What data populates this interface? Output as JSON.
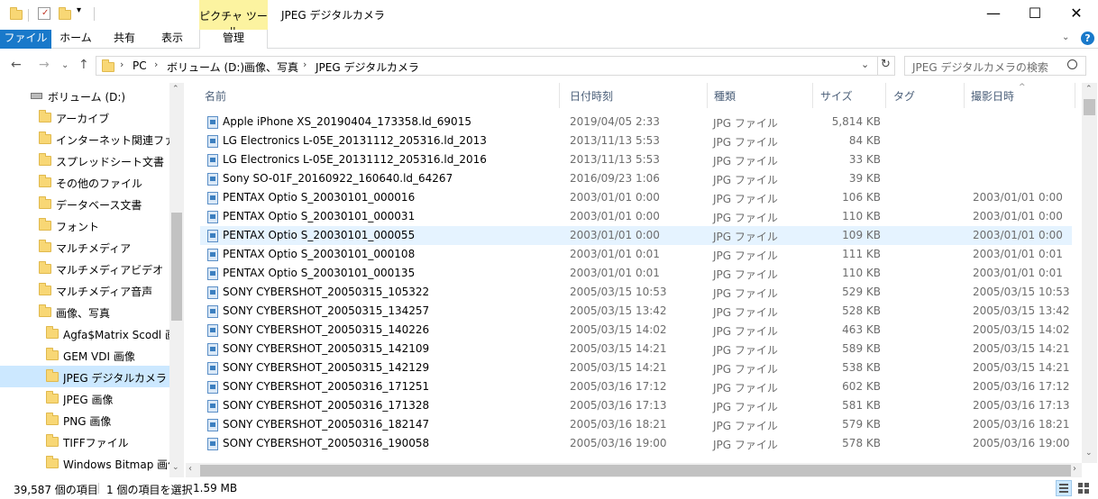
{
  "window": {
    "title": "JPEG デジタルカメラ",
    "context_tab": "ピクチャ ツール",
    "minimize_icon": "minimize-icon",
    "maximize_icon": "maximize-icon",
    "close_icon": "close-icon"
  },
  "ribbon": {
    "tabs": [
      "ファイル",
      "ホーム",
      "共有",
      "表示"
    ],
    "context_tab_label": "管理"
  },
  "nav": {
    "breadcrumb": [
      "PC",
      "ボリューム (D:)",
      "画像、写真",
      "JPEG デジタルカメラ"
    ],
    "search_placeholder": "JPEG デジタルカメラの検索"
  },
  "tree": [
    {
      "label": "ボリューム (D:)",
      "icon": "drive-icon",
      "indent": 1
    },
    {
      "label": "アーカイブ",
      "icon": "folder-icon",
      "indent": 2
    },
    {
      "label": "インターネット関連ファイル",
      "icon": "folder-icon",
      "indent": 2
    },
    {
      "label": "スプレッドシート文書",
      "icon": "folder-icon",
      "indent": 2
    },
    {
      "label": "その他のファイル",
      "icon": "folder-icon",
      "indent": 2
    },
    {
      "label": "データベース文書",
      "icon": "folder-icon",
      "indent": 2
    },
    {
      "label": "フォント",
      "icon": "folder-icon",
      "indent": 2
    },
    {
      "label": "マルチメディア",
      "icon": "folder-icon",
      "indent": 2
    },
    {
      "label": "マルチメディアビデオ",
      "icon": "folder-icon",
      "indent": 2
    },
    {
      "label": "マルチメディア音声",
      "icon": "folder-icon",
      "indent": 2
    },
    {
      "label": "画像、写真",
      "icon": "folder-icon",
      "indent": 2
    },
    {
      "label": "Agfa$Matrix Scodl 画像",
      "icon": "folder-icon",
      "indent": 3
    },
    {
      "label": "GEM VDI 画像",
      "icon": "folder-icon",
      "indent": 3
    },
    {
      "label": "JPEG デジタルカメラ",
      "icon": "folder-icon",
      "indent": 3,
      "selected": true
    },
    {
      "label": "JPEG 画像",
      "icon": "folder-icon",
      "indent": 3
    },
    {
      "label": "PNG 画像",
      "icon": "folder-icon",
      "indent": 3
    },
    {
      "label": "TIFFファイル",
      "icon": "folder-icon",
      "indent": 3
    },
    {
      "label": "Windows Bitmap 画像",
      "icon": "folder-icon",
      "indent": 3
    }
  ],
  "columns": [
    "名前",
    "日付時刻",
    "種類",
    "サイズ",
    "タグ",
    "撮影日時"
  ],
  "files": [
    {
      "name": "Apple iPhone XS_20190404_173358.ld_69015",
      "date": "2019/04/05 2:33",
      "type": "JPG ファイル",
      "size": "5,814 KB",
      "shot": ""
    },
    {
      "name": "LG Electronics L-05E_20131112_205316.ld_2013",
      "date": "2013/11/13 5:53",
      "type": "JPG ファイル",
      "size": "84 KB",
      "shot": ""
    },
    {
      "name": "LG Electronics L-05E_20131112_205316.ld_2016",
      "date": "2013/11/13 5:53",
      "type": "JPG ファイル",
      "size": "33 KB",
      "shot": ""
    },
    {
      "name": "Sony SO-01F_20160922_160640.ld_64267",
      "date": "2016/09/23 1:06",
      "type": "JPG ファイル",
      "size": "39 KB",
      "shot": ""
    },
    {
      "name": "PENTAX Optio S_20030101_000016",
      "date": "2003/01/01 0:00",
      "type": "JPG ファイル",
      "size": "106 KB",
      "shot": "2003/01/01 0:00"
    },
    {
      "name": "PENTAX Optio S_20030101_000031",
      "date": "2003/01/01 0:00",
      "type": "JPG ファイル",
      "size": "110 KB",
      "shot": "2003/01/01 0:00"
    },
    {
      "name": "PENTAX Optio S_20030101_000055",
      "date": "2003/01/01 0:00",
      "type": "JPG ファイル",
      "size": "109 KB",
      "shot": "2003/01/01 0:00",
      "selected": true
    },
    {
      "name": "PENTAX Optio S_20030101_000108",
      "date": "2003/01/01 0:01",
      "type": "JPG ファイル",
      "size": "111 KB",
      "shot": "2003/01/01 0:01"
    },
    {
      "name": "PENTAX Optio S_20030101_000135",
      "date": "2003/01/01 0:01",
      "type": "JPG ファイル",
      "size": "110 KB",
      "shot": "2003/01/01 0:01"
    },
    {
      "name": "SONY CYBERSHOT_20050315_105322",
      "date": "2005/03/15 10:53",
      "type": "JPG ファイル",
      "size": "529 KB",
      "shot": "2005/03/15 10:53"
    },
    {
      "name": "SONY CYBERSHOT_20050315_134257",
      "date": "2005/03/15 13:42",
      "type": "JPG ファイル",
      "size": "528 KB",
      "shot": "2005/03/15 13:42"
    },
    {
      "name": "SONY CYBERSHOT_20050315_140226",
      "date": "2005/03/15 14:02",
      "type": "JPG ファイル",
      "size": "463 KB",
      "shot": "2005/03/15 14:02"
    },
    {
      "name": "SONY CYBERSHOT_20050315_142109",
      "date": "2005/03/15 14:21",
      "type": "JPG ファイル",
      "size": "589 KB",
      "shot": "2005/03/15 14:21"
    },
    {
      "name": "SONY CYBERSHOT_20050315_142129",
      "date": "2005/03/15 14:21",
      "type": "JPG ファイル",
      "size": "538 KB",
      "shot": "2005/03/15 14:21"
    },
    {
      "name": "SONY CYBERSHOT_20050316_171251",
      "date": "2005/03/16 17:12",
      "type": "JPG ファイル",
      "size": "602 KB",
      "shot": "2005/03/16 17:12"
    },
    {
      "name": "SONY CYBERSHOT_20050316_171328",
      "date": "2005/03/16 17:13",
      "type": "JPG ファイル",
      "size": "581 KB",
      "shot": "2005/03/16 17:13"
    },
    {
      "name": "SONY CYBERSHOT_20050316_182147",
      "date": "2005/03/16 18:21",
      "type": "JPG ファイル",
      "size": "579 KB",
      "shot": "2005/03/16 18:21"
    },
    {
      "name": "SONY CYBERSHOT_20050316_190058",
      "date": "2005/03/16 19:00",
      "type": "JPG ファイル",
      "size": "578 KB",
      "shot": "2005/03/16 19:00"
    }
  ],
  "status": {
    "item_count": "39,587 個の項目",
    "selection": "1 個の項目を選択",
    "selection_size": "1.59 MB"
  }
}
